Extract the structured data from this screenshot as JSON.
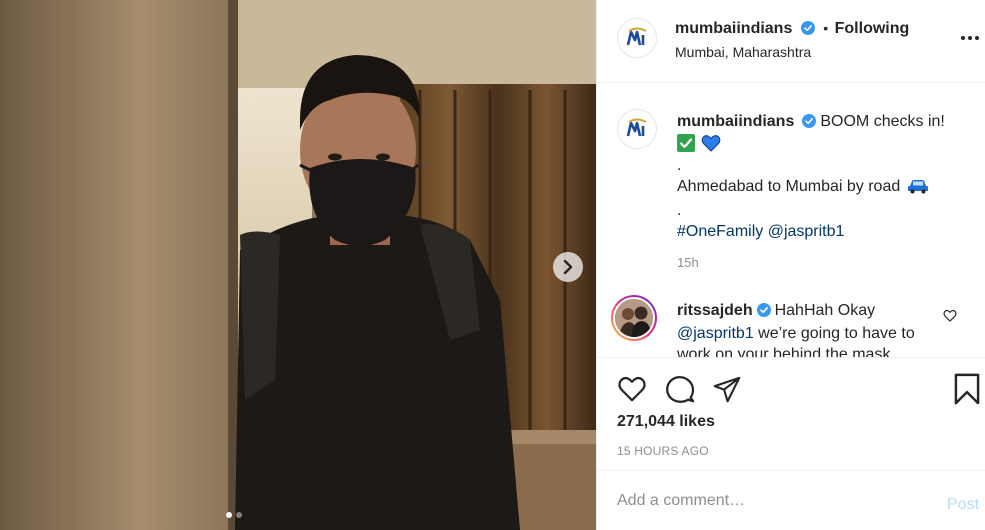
{
  "post": {
    "author": {
      "handle": "mumbaiindians",
      "separator": "•",
      "follow_status": "Following",
      "location": "Mumbai, Maharashtra"
    },
    "media": {
      "next_icon": "chevron-right-icon",
      "carousel_count": 2,
      "carousel_active_index": 0
    },
    "caption": {
      "handle": "mumbaiindians",
      "text": "BOOM checks in!",
      "emojis": [
        "white-check-mark-emoji",
        "blue-heart-emoji"
      ],
      "dot1": ".",
      "route": "Ahmedabad to Mumbai by road",
      "route_emoji": "car-emoji",
      "dot2": ".",
      "hashtag": "#OneFamily",
      "mention": "@jaspritb1",
      "time": "15h"
    },
    "comments": [
      {
        "handle": "ritssajdeh",
        "text_start": "HahHah Okay",
        "mention": "@jaspritb1",
        "text_end": "we’re going to have to work on your behind the mask",
        "like_icon": "heart-outline-icon"
      }
    ],
    "likes": "271,044 likes",
    "time_ago": "15 HOURS AGO",
    "add_comment": {
      "placeholder": "Add a comment…",
      "post_label": "Post"
    }
  },
  "colors": {
    "verified": "#3897f0",
    "link": "#00376b",
    "secondary_text": "#8e8e8e",
    "post_disabled": "#b2dffc",
    "mi_blue": "#1a4b9c",
    "mi_gold": "#d4a73c"
  }
}
